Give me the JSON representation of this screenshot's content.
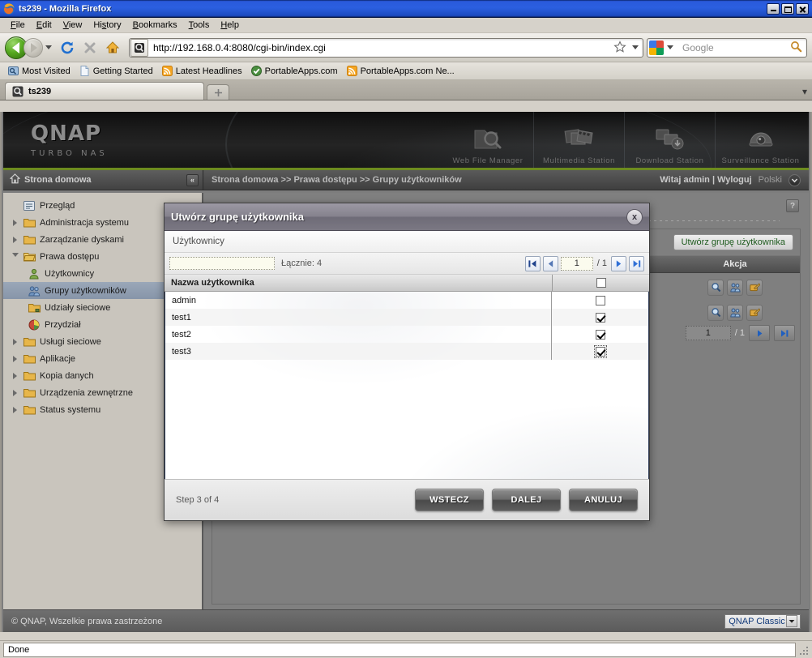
{
  "window": {
    "title": "ts239 - Mozilla Firefox",
    "controls": {
      "minimize": "Minimize",
      "maximize": "Maximize",
      "close": "Close"
    }
  },
  "menu": {
    "items": [
      "File",
      "Edit",
      "View",
      "History",
      "Bookmarks",
      "Tools",
      "Help"
    ]
  },
  "toolbar": {
    "back": "Back",
    "forward": "Forward",
    "reload": "Reload",
    "stop": "Stop",
    "home": "Home",
    "url": "http://192.168.0.4:8080/cgi-bin/index.cgi",
    "bookmark_star": "star-icon",
    "search_placeholder": "Google",
    "search_value": "",
    "search_engine": "Google"
  },
  "bookmarks": [
    {
      "label": "Most Visited",
      "icon": "most-visited-icon"
    },
    {
      "label": "Getting Started",
      "icon": "page-icon"
    },
    {
      "label": "Latest Headlines",
      "icon": "rss-icon"
    },
    {
      "label": "PortableApps.com",
      "icon": "portableapps-icon"
    },
    {
      "label": "PortableApps.com Ne...",
      "icon": "rss-icon"
    }
  ],
  "tabs": {
    "active": {
      "label": "ts239",
      "favicon": "qnap-favicon"
    },
    "new_tab_label": "+",
    "list_all_label": "▾"
  },
  "qnap_header": {
    "logo": "QNAP",
    "tagline": "TURBO NAS",
    "apps": [
      {
        "label": "Web File Manager",
        "icon": "folder-search-icon"
      },
      {
        "label": "Multimedia Station",
        "icon": "multimedia-icon"
      },
      {
        "label": "Download Station",
        "icon": "download-icon"
      },
      {
        "label": "Surveillance Station",
        "icon": "camera-icon"
      }
    ]
  },
  "crumbbar": {
    "home_label": "Strona domowa",
    "home_icon": "home-icon",
    "collapse_icon": "chevron-left-double-icon",
    "breadcrumb": "Strona domowa >> Prawa dostępu >> Grupy użytkowników",
    "welcome": "Witaj admin | Wyloguj",
    "language": "Polski"
  },
  "sidebar": {
    "items": [
      {
        "label": "Przegląd",
        "icon": "overview-icon",
        "level": 0,
        "twisty": "none",
        "selected": false
      },
      {
        "label": "Administracja systemu",
        "icon": "folder-icon",
        "level": 0,
        "twisty": "closed",
        "selected": false
      },
      {
        "label": "Zarządzanie dyskami",
        "icon": "folder-icon",
        "level": 0,
        "twisty": "closed",
        "selected": false
      },
      {
        "label": "Prawa dostępu",
        "icon": "folder-open-icon",
        "level": 0,
        "twisty": "open",
        "selected": false
      },
      {
        "label": "Użytkownicy",
        "icon": "user-icon",
        "level": 1,
        "twisty": "none",
        "selected": false
      },
      {
        "label": "Grupy użytkowników",
        "icon": "users-group-icon",
        "level": 1,
        "twisty": "none",
        "selected": true
      },
      {
        "label": "Udziały sieciowe",
        "icon": "share-folder-icon",
        "level": 1,
        "twisty": "none",
        "selected": false
      },
      {
        "label": "Przydział",
        "icon": "quota-icon",
        "level": 1,
        "twisty": "none",
        "selected": false
      },
      {
        "label": "Usługi sieciowe",
        "icon": "folder-icon",
        "level": 0,
        "twisty": "closed",
        "selected": false
      },
      {
        "label": "Aplikacje",
        "icon": "folder-icon",
        "level": 0,
        "twisty": "closed",
        "selected": false
      },
      {
        "label": "Kopia danych",
        "icon": "folder-icon",
        "level": 0,
        "twisty": "closed",
        "selected": false
      },
      {
        "label": "Urządzenia zewnętrzne",
        "icon": "folder-icon",
        "level": 0,
        "twisty": "closed",
        "selected": false
      },
      {
        "label": "Status systemu",
        "icon": "folder-icon",
        "level": 0,
        "twisty": "closed",
        "selected": false
      }
    ]
  },
  "background_page": {
    "help_label": "?",
    "create_button": "Utwórz grupę użytkownika",
    "action_column": "Akcja",
    "row_actions": [
      "details-icon",
      "members-icon",
      "edit-icon"
    ],
    "rows": 2,
    "pager": {
      "page": "1",
      "of": "/ 1",
      "next": "next-page-icon",
      "last": "last-page-icon"
    }
  },
  "page_footer": {
    "copyright": "© QNAP, Wszelkie prawa zastrzeżone",
    "theme": "QNAP Classic"
  },
  "modal": {
    "title": "Utwórz grupę użytkownika",
    "close_label": "x",
    "section_label": "Użytkownicy",
    "filter_value": "",
    "total_label": "Łącznie:",
    "total_value": "4",
    "pager": {
      "first": "first-page-icon",
      "prev": "prev-page-icon",
      "page": "1",
      "of": "/ 1",
      "next": "next-page-icon",
      "last": "last-page-icon"
    },
    "table": {
      "columns": [
        "Nazwa użytkownika",
        ""
      ],
      "header_checkbox": false,
      "rows": [
        {
          "name": "admin",
          "checked": false,
          "focused": false
        },
        {
          "name": "test1",
          "checked": true,
          "focused": false
        },
        {
          "name": "test2",
          "checked": true,
          "focused": false
        },
        {
          "name": "test3",
          "checked": true,
          "focused": true
        }
      ]
    },
    "step_text": "Step 3 of 4",
    "buttons": {
      "back": "WSTECZ",
      "next": "DALEJ",
      "cancel": "ANULUJ"
    }
  },
  "status": {
    "text": "Done"
  }
}
